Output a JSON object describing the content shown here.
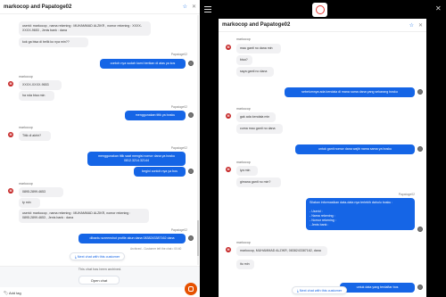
{
  "left": {
    "title": "markocop and Papatoge02",
    "header_icons": [
      "star-icon",
      "close-icon"
    ],
    "messages": [
      {
        "side": "in",
        "text": "userid: markocop , nama rekening : MUHAMMAD ALZIKR , nomor rekening : XXXX-XXXX-9653 , Jenis bank : dana"
      },
      {
        "side": "in",
        "text": "kok ga bisa di belik ko nya min??"
      },
      {
        "side": "sender-r",
        "text": "Papatoge02"
      },
      {
        "side": "out",
        "text": "contoh nya sudah kami berikan di atas ya kos"
      },
      {
        "side": "sender-l",
        "text": "markocop"
      },
      {
        "side": "in",
        "text": "XXXX-XXXX-9653"
      },
      {
        "side": "in",
        "text": "ha nda bisa min"
      },
      {
        "side": "sender-r",
        "text": "Papatoge02"
      },
      {
        "side": "out",
        "text": "menggunakan titik ya bosku"
      },
      {
        "side": "sender-l",
        "text": "markocop"
      },
      {
        "side": "in",
        "text": "Titik di akhir?"
      },
      {
        "side": "sender-r",
        "text": "Papatoge02"
      },
      {
        "side": "out",
        "text": "menggunakan titik saat mengisi nomor dana ya bosku 0812.3214.32144"
      },
      {
        "side": "out",
        "text": "begini contoh nya ya bos"
      },
      {
        "side": "sender-l",
        "text": "markocop"
      },
      {
        "side": "in",
        "text": "0895.2899.4653"
      },
      {
        "side": "in",
        "text": "ty min"
      },
      {
        "side": "in",
        "text": "userid: markocop , nama rekening : MUHAMMAD ALZIKR, nomor rekening : 0895.2899.4653 , Jenis bank : dana"
      },
      {
        "side": "sender-r",
        "text": "Papatoge02"
      },
      {
        "side": "out",
        "text": "dibantu screenshot profile akun dana 0838243387162 dana"
      }
    ],
    "system_note": "Archived - Customer left the chat • 00:40",
    "new_chat_label": "⤓ Next chat with this customer",
    "archived_text": "This chat has been archived.",
    "open_chat_label": "Open chat",
    "add_tag_label": "🏷 Add tag"
  },
  "right": {
    "title": "markocop and Papatoge02",
    "header_icons": [
      "star-icon",
      "close-icon"
    ],
    "messages": [
      {
        "side": "sender-l",
        "text": "markocop"
      },
      {
        "side": "in",
        "text": "mau ganti no dana min"
      },
      {
        "side": "in",
        "text": "bisa?"
      },
      {
        "side": "in",
        "text": "saya ganti no dana"
      },
      {
        "side": "out",
        "text": "sebelumnya ada kendala di mana sama dana yang sekarang bosku"
      },
      {
        "side": "sender-l",
        "text": "markocop"
      },
      {
        "side": "in",
        "text": "gak ada kendala min"
      },
      {
        "side": "in",
        "text": "cuma mau ganti no dana"
      },
      {
        "side": "out",
        "text": "untuk ganti nomor dana wajib nama sama ya bosku"
      },
      {
        "side": "sender-l",
        "text": "markocop"
      },
      {
        "side": "in",
        "text": "iya min"
      },
      {
        "side": "in",
        "text": "gimana ganti no min?"
      },
      {
        "side": "sender-r",
        "text": "Papatoge02"
      },
      {
        "side": "out",
        "text": "Silakan informasikan data-data nya terlebih dahulu bosku :\n\n- Userid :\n- Nama rekening :\n- Nomor rekening :\n- Jenis bank :"
      },
      {
        "side": "sender-l",
        "text": "markocop"
      },
      {
        "side": "in",
        "text": "markocop, MUHAMMAD ALZIKR, 0838243387162, dana"
      },
      {
        "side": "in",
        "text": "itu min"
      },
      {
        "side": "out",
        "text": "untuk data yang terdaftar bos"
      }
    ],
    "new_chat_label": "⤓ Next chat with this customer"
  },
  "colors": {
    "accent": "#1565e6",
    "avatar": "#c62828",
    "fab": "#e65100"
  }
}
